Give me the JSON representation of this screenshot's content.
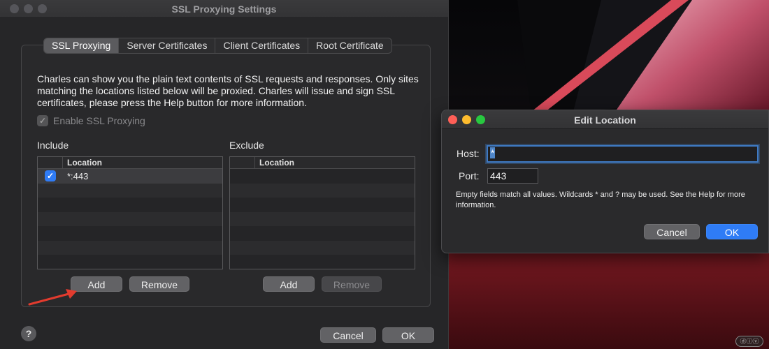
{
  "main_window": {
    "title": "SSL Proxying Settings",
    "tabs": [
      {
        "label": "SSL Proxying",
        "selected": true
      },
      {
        "label": "Server Certificates",
        "selected": false
      },
      {
        "label": "Client Certificates",
        "selected": false
      },
      {
        "label": "Root Certificate",
        "selected": false
      }
    ],
    "description": "Charles can show you the plain text contents of SSL requests and responses. Only sites matching the locations listed below will be proxied. Charles will issue and sign SSL certificates, please press the Help button for more information.",
    "enable_checkbox": {
      "label": "Enable SSL Proxying",
      "checked": true,
      "enabled": false
    },
    "include": {
      "label": "Include",
      "column": "Location",
      "rows": [
        {
          "checked": true,
          "location": "*:443"
        }
      ],
      "add_label": "Add",
      "remove_label": "Remove"
    },
    "exclude": {
      "label": "Exclude",
      "column": "Location",
      "rows": [],
      "add_label": "Add",
      "remove_label": "Remove"
    },
    "help_label": "?",
    "cancel_label": "Cancel",
    "ok_label": "OK"
  },
  "edit_window": {
    "title": "Edit Location",
    "host_label": "Host:",
    "host_value": "*",
    "port_label": "Port:",
    "port_value": "443",
    "hint": "Empty fields match all values. Wildcards * and ? may be used. See the Help for more information.",
    "cancel_label": "Cancel",
    "ok_label": "OK"
  },
  "icons": {
    "check": "✓",
    "arrow_color": "#e23b2e"
  },
  "watermark": "ⓓⓘⓥ"
}
